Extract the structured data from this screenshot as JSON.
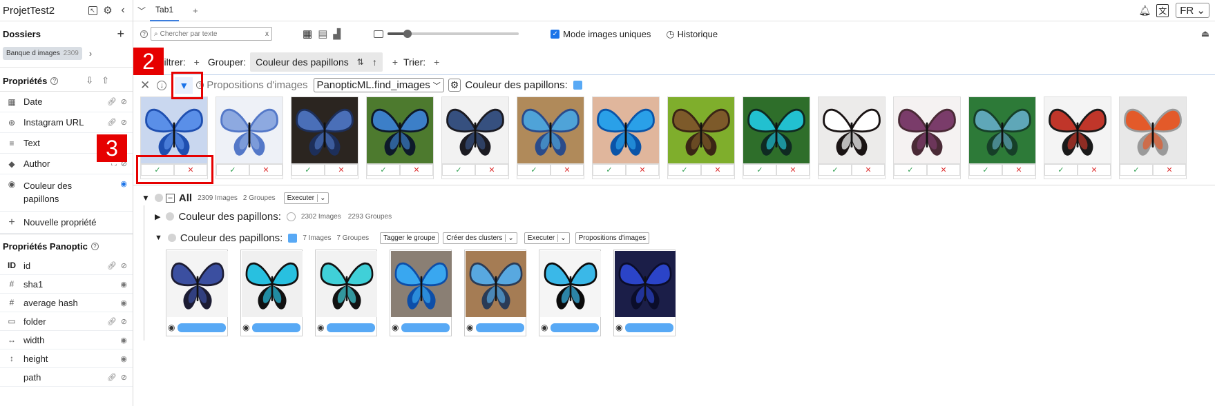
{
  "project": {
    "title": "ProjetTest2"
  },
  "sidebar": {
    "folders_title": "Dossiers",
    "folder_chip": {
      "label": "Banque d images",
      "count": "2309"
    },
    "properties_title": "Propriétés",
    "properties": [
      {
        "icon": "calendar-icon",
        "glyph": "▦",
        "label": "Date"
      },
      {
        "icon": "globe-icon",
        "glyph": "⊕",
        "label": "Instagram URL"
      },
      {
        "icon": "text-lines-icon",
        "glyph": "≡",
        "label": "Text"
      },
      {
        "icon": "tag-icon",
        "glyph": "◆",
        "label": "Author"
      },
      {
        "icon": "palette-icon",
        "glyph": "◉",
        "label": "Couleur des papillons"
      }
    ],
    "new_property": "Nouvelle propriété",
    "panoptic_title": "Propriétés Panoptic",
    "panoptic_props": [
      {
        "glyph": "ID",
        "label": "id"
      },
      {
        "glyph": "#",
        "label": "sha1"
      },
      {
        "glyph": "#",
        "label": "average hash"
      },
      {
        "glyph": "▭",
        "label": "folder"
      },
      {
        "glyph": "↔",
        "label": "width"
      },
      {
        "glyph": "↕",
        "label": "height"
      },
      {
        "glyph": "</>",
        "label": "path"
      }
    ]
  },
  "tabs": [
    {
      "label": "Tab1"
    }
  ],
  "tab_add": "+",
  "language": "FR",
  "toolbar": {
    "search_placeholder": "Chercher par texte",
    "search_clear": "x",
    "zoom_level": 0.15,
    "unique_mode_label": "Mode images uniques",
    "history_label": "Historique"
  },
  "filterbar": {
    "filter_label": "Filtrer:",
    "group_label": "Grouper:",
    "group_value": "Couleur des papillons",
    "sort_label": "Trier:"
  },
  "propositions": {
    "title": "Propositions d'images",
    "function": "PanopticML.find_images",
    "property": "Couleur des papillons:",
    "accept": "✓",
    "reject": "✕",
    "images": [
      {
        "name": "blue-morpho",
        "colors": [
          "#1f4fb0",
          "#5a8fe8",
          "#c9d7ef"
        ]
      },
      {
        "name": "lycaenid-blue",
        "colors": [
          "#5478c8",
          "#8da9e0",
          "#eef1f7"
        ]
      },
      {
        "name": "admiral-blue",
        "colors": [
          "#1d2f5a",
          "#4a6fb8",
          "#2b2520"
        ]
      },
      {
        "name": "blue-on-leaf",
        "colors": [
          "#0e1a2a",
          "#3c7fc8",
          "#4d7a2e"
        ]
      },
      {
        "name": "dark-blue-specimen",
        "colors": [
          "#1b1b22",
          "#36507f",
          "#f2f2f2"
        ]
      },
      {
        "name": "tropical-blue",
        "colors": [
          "#2a4b8a",
          "#4fa3d8",
          "#b08a5a"
        ]
      },
      {
        "name": "morpho-hand",
        "colors": [
          "#0a54a8",
          "#2aa0e8",
          "#e0b69c"
        ]
      },
      {
        "name": "brown-on-leaf",
        "colors": [
          "#3a2515",
          "#7d5a2a",
          "#7fae2c"
        ]
      },
      {
        "name": "swallowtail-cyan",
        "colors": [
          "#0f2a22",
          "#22c0d0",
          "#2e6e2a"
        ]
      },
      {
        "name": "white-swallowtail",
        "colors": [
          "#1a1414",
          "#ffffff",
          "#ecebea"
        ]
      },
      {
        "name": "purple-brown",
        "colors": [
          "#4a2a36",
          "#7a3c6a",
          "#f5f2f2"
        ]
      },
      {
        "name": "green-blue-leaf",
        "colors": [
          "#163f28",
          "#5fa7b8",
          "#2d7a38"
        ]
      },
      {
        "name": "red-black-white",
        "colors": [
          "#1a1a1a",
          "#c0362a",
          "#f4f4f4"
        ]
      },
      {
        "name": "white-orange-tip",
        "colors": [
          "#9a9a9a",
          "#e35a2a",
          "#e8e8e8"
        ]
      }
    ]
  },
  "groups": {
    "root": {
      "label": "All",
      "count": "2309 Images",
      "groups": "2 Groupes",
      "action": "Executer"
    },
    "items": [
      {
        "label": "Couleur des papillons:",
        "count": "2302 Images",
        "groups": "2293 Groupes",
        "expanded": false
      },
      {
        "label": "Couleur des papillons:",
        "count": "7 Images",
        "groups": "7 Groupes",
        "expanded": true,
        "actions": [
          "Tagger le groupe",
          "Créer des clusters",
          "Executer",
          "Propositions d'images"
        ]
      }
    ],
    "images": [
      {
        "name": "blue-dark-1",
        "colors": [
          "#1c1c33",
          "#3b4fa0",
          "#f4f4f4"
        ]
      },
      {
        "name": "swallowtail-1",
        "colors": [
          "#111111",
          "#28c0e0",
          "#f0f0f0"
        ]
      },
      {
        "name": "swallowtail-2",
        "colors": [
          "#121212",
          "#40d0d8",
          "#f2f2f2"
        ]
      },
      {
        "name": "morpho-1",
        "colors": [
          "#0d4ea8",
          "#39a7f0",
          "#8a7f74"
        ]
      },
      {
        "name": "morpho-2",
        "colors": [
          "#2a3b56",
          "#58a8e0",
          "#a57c54"
        ]
      },
      {
        "name": "swallowtail-3",
        "colors": [
          "#0b0b0b",
          "#3ab8e8",
          "#f5f5f5"
        ]
      },
      {
        "name": "blue-specimen",
        "colors": [
          "#0b0d2a",
          "#2b44c8",
          "#1b1e48"
        ]
      }
    ],
    "tag_color": "#58a9f5"
  },
  "annotations": [
    {
      "number": "2"
    },
    {
      "number": "3"
    }
  ],
  "colors": {
    "accent": "#1a73e8",
    "annotation": "#e60000",
    "tag": "#58a9f5"
  }
}
